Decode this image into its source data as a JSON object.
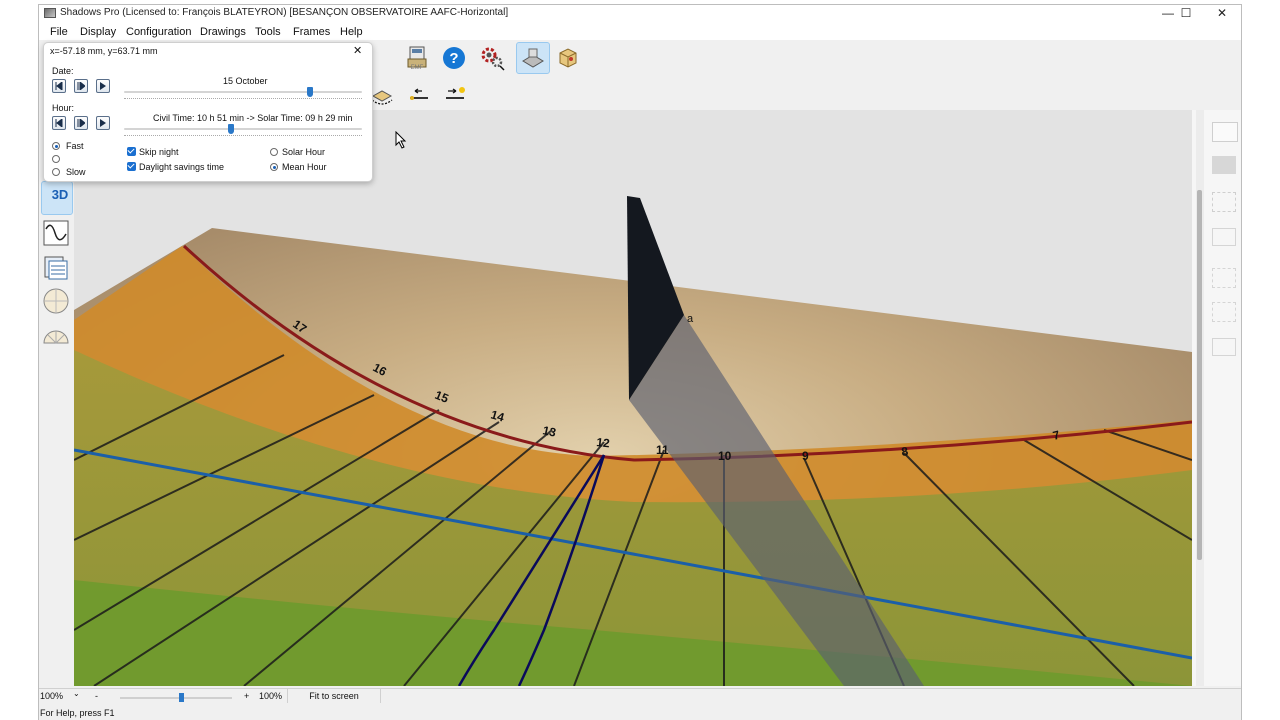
{
  "window": {
    "title": "Shadows Pro  (Licensed to:  François BLATEYRON) [BESANÇON OBSERVATOIRE AAFC-Horizontal]",
    "minimize": "—",
    "maximize": "☐",
    "close": "✕"
  },
  "menu": [
    "File",
    "Display",
    "Configuration",
    "Drawings",
    "Tools",
    "Frames",
    "Help"
  ],
  "toolbar": {
    "row1_icons": [
      "emf-export-icon",
      "help-icon",
      "settings-gears-icon",
      "view-toggle-icon",
      "box-3d-icon"
    ],
    "row2_icons": [
      "rotate-view-icon",
      "sun-left-icon",
      "sun-right-icon"
    ],
    "help_glyph": "?",
    "emf_label": "EMF"
  },
  "left_tools": {
    "view_3d_label": "3D",
    "icons": [
      "view-3d-icon",
      "curve-icon",
      "table-icon",
      "sphere-dial-icon",
      "half-dial-icon"
    ]
  },
  "popup": {
    "coords": "x=-57.18 mm, y=63.71 mm",
    "close_glyph": "✕",
    "date_label": "Date:",
    "date_value": "15 October",
    "date_slider_fraction": 0.78,
    "hour_label": "Hour:",
    "time_text": "Civil Time: 10 h 51 min -> Solar Time: 09 h 29 min",
    "hour_slider_fraction": 0.45,
    "speed_fast": "Fast",
    "speed_slow": "Slow",
    "speed_selected": "Fast",
    "skip_night": "Skip night",
    "skip_night_checked": true,
    "dst": "Daylight savings time",
    "dst_checked": true,
    "solar_hour": "Solar Hour",
    "mean_hour": "Mean Hour",
    "hour_mode_selected": "Mean Hour"
  },
  "scene": {
    "hour_numbers": [
      "17",
      "16",
      "15",
      "14",
      "13",
      "12",
      "11",
      "10",
      "9",
      "8",
      "7"
    ],
    "gnomon_marker": "a"
  },
  "bottom": {
    "zoom_left": "100%",
    "zoom_minus": "-",
    "zoom_plus": "+",
    "zoom_right": "100%",
    "fit": "Fit to screen",
    "status": "For Help, press F1"
  },
  "colors": {
    "shadow_line": "#0a0a5a",
    "equinox_line": "#1b5fa8",
    "dial_edge": "#8a1a1a",
    "gnomon": "#14181f",
    "accent": "#2a78c8"
  }
}
